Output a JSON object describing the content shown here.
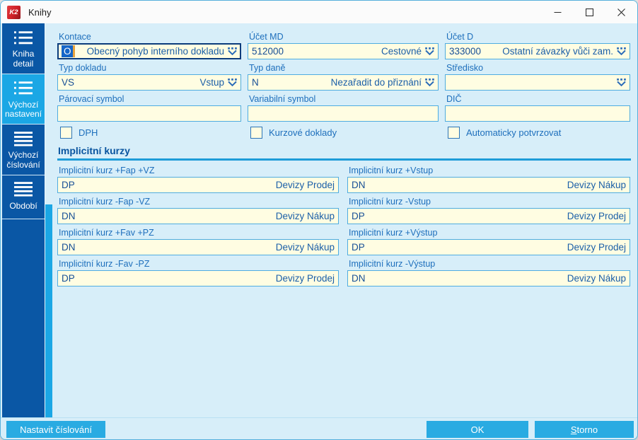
{
  "window": {
    "title": "Knihy",
    "logo_text": "K2"
  },
  "sidebar": {
    "items": [
      {
        "id": "kniha-detail",
        "label": "Kniha detail",
        "icon": "list-detail-icon",
        "selected": false
      },
      {
        "id": "vychozi-nastaveni",
        "label": "Výchozí nastavení",
        "icon": "list-detail-icon",
        "selected": true
      },
      {
        "id": "vychozi-cislovani",
        "label": "Výchozí číslování",
        "icon": "menu-lines-icon",
        "selected": false
      },
      {
        "id": "obdobi",
        "label": "Období",
        "icon": "menu-lines-icon",
        "selected": false
      }
    ]
  },
  "form": {
    "fields": [
      {
        "id": "kontace",
        "label": "Kontace",
        "code": "O",
        "desc": "Obecný pohyb interního dokladu",
        "dropdown": true,
        "focused": true
      },
      {
        "id": "ucet-md",
        "label": "Účet MD",
        "code": "512000",
        "desc": "Cestovné",
        "dropdown": true,
        "focused": false
      },
      {
        "id": "ucet-d",
        "label": "Účet D",
        "code": "333000",
        "desc": "Ostatní závazky vůči zam.",
        "dropdown": true,
        "focused": false
      },
      {
        "id": "typ-dokladu",
        "label": "Typ dokladu",
        "code": "VS",
        "desc": "Vstup",
        "dropdown": true,
        "focused": false
      },
      {
        "id": "typ-dane",
        "label": "Typ daně",
        "code": "N",
        "desc": "Nezařadit do přiznání",
        "dropdown": true,
        "focused": false
      },
      {
        "id": "stredisko",
        "label": "Středisko",
        "code": "",
        "desc": "",
        "dropdown": true,
        "focused": false
      },
      {
        "id": "parovaci-symbol",
        "label": "Párovací symbol",
        "code": "",
        "desc": "",
        "dropdown": false,
        "focused": false
      },
      {
        "id": "variabilni-symbol",
        "label": "Variabilní symbol",
        "code": "",
        "desc": "",
        "dropdown": false,
        "focused": false
      },
      {
        "id": "dic",
        "label": "DIČ",
        "code": "",
        "desc": "",
        "dropdown": false,
        "focused": false
      }
    ],
    "checkboxes": [
      {
        "id": "dph",
        "label": "DPH",
        "checked": false
      },
      {
        "id": "kurzove-doklady",
        "label": "Kurzové doklady",
        "checked": false
      },
      {
        "id": "automaticky-potvrzovat",
        "label": "Automaticky potvrzovat",
        "checked": false
      }
    ],
    "section_title": "Implicitní kurzy",
    "kurz_fields": [
      {
        "id": "kurz-plus-fap-vz",
        "label": "Implicitní kurz +Fap +VZ",
        "code": "DP",
        "desc": "Devizy Prodej"
      },
      {
        "id": "kurz-plus-vstup",
        "label": "Implicitní kurz +Vstup",
        "code": "DN",
        "desc": "Devizy Nákup"
      },
      {
        "id": "kurz-minus-fap-vz",
        "label": "Implicitní kurz -Fap -VZ",
        "code": "DN",
        "desc": "Devizy Nákup"
      },
      {
        "id": "kurz-minus-vstup",
        "label": "Implicitní kurz -Vstup",
        "code": "DP",
        "desc": "Devizy Prodej"
      },
      {
        "id": "kurz-plus-fav-pz",
        "label": "Implicitní kurz +Fav +PZ",
        "code": "DN",
        "desc": "Devizy Nákup"
      },
      {
        "id": "kurz-plus-vystup",
        "label": "Implicitní kurz +Výstup",
        "code": "DP",
        "desc": "Devizy Prodej"
      },
      {
        "id": "kurz-minus-fav-pz",
        "label": "Implicitní kurz -Fav -PZ",
        "code": "DP",
        "desc": "Devizy Prodej"
      },
      {
        "id": "kurz-minus-vystup",
        "label": "Implicitní kurz -Výstup",
        "code": "DN",
        "desc": "Devizy Nákup"
      }
    ]
  },
  "footer": {
    "settings_button": "Nastavit číslování",
    "ok_button": "OK",
    "storno_accel": "S",
    "storno_rest": "torno"
  },
  "colors": {
    "sidebar": "#0A57A5",
    "sidebar_selected": "#1BA7E5",
    "content_bg": "#D7EEF9",
    "field_bg": "#FFFDE2",
    "field_border": "#4FACE0",
    "field_text": "#1B5FA8",
    "label_text": "#1E6FBC",
    "accent_button": "#29ABE2",
    "selection_bg": "#1566C8",
    "caret": "#E8A33D",
    "section_title": "#0A55A0",
    "divider": "#1E9CD8"
  }
}
